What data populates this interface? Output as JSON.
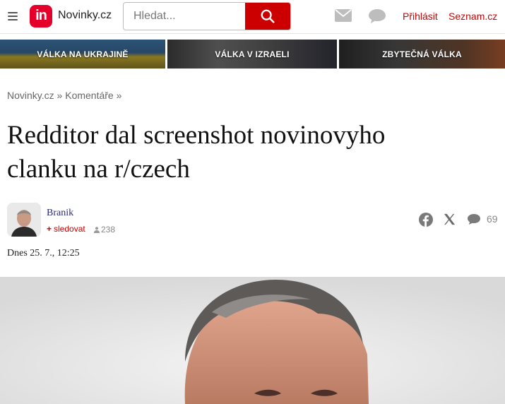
{
  "header": {
    "logo_text": "in",
    "site_name": "Novinky.cz",
    "search_placeholder": "Hledat...",
    "login_label": "Přihlásit",
    "seznam_label": "Seznam.cz",
    "brand_color": "#e4002b",
    "icons": [
      "menu-icon",
      "search-icon",
      "mail-icon",
      "chat-icon"
    ]
  },
  "banners": [
    {
      "label": "VÁLKA NA UKRAJINĚ"
    },
    {
      "label": "VÁLKA V IZRAELI"
    },
    {
      "label": "ZBYTEČNÁ VÁLKA"
    }
  ],
  "breadcrumb": {
    "items": [
      "Novinky.cz",
      "Komentáře"
    ],
    "separator": "»"
  },
  "article": {
    "title": "Redditor dal screenshot novinovyho clanku na r/czech",
    "author": {
      "name": "Branik",
      "follow_label": "sledovat",
      "followers": "238"
    },
    "comments_count": "69",
    "date": "Dnes 25. 7., 12:25"
  }
}
